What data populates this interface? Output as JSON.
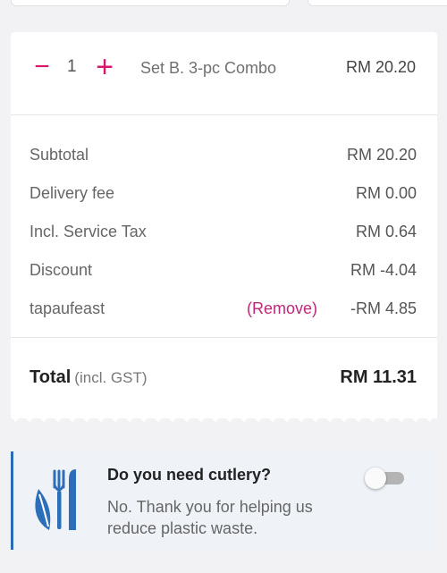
{
  "cart_item": {
    "quantity": "1",
    "minus_symbol": "−",
    "plus_symbol": "+",
    "name": "Set B. 3-pc Combo",
    "price": "RM 20.20"
  },
  "summary": {
    "subtotal": {
      "label": "Subtotal",
      "value": "RM 20.20"
    },
    "delivery_fee": {
      "label": "Delivery fee",
      "value": "RM 0.00"
    },
    "service_tax": {
      "label": "Incl. Service Tax",
      "value": "RM 0.64"
    },
    "discount": {
      "label": "Discount",
      "value": "RM -4.04"
    },
    "voucher": {
      "label": "tapaufeast",
      "remove_label": "(Remove)",
      "value": "-RM 4.85"
    }
  },
  "total": {
    "label": "Total",
    "note": "(incl. GST)",
    "value": "RM 11.31"
  },
  "cutlery": {
    "title": "Do you need cutlery?",
    "description": "No. Thank you for helping us reduce plastic waste.",
    "icon": "leaf-cutlery-icon",
    "toggle_on": false
  },
  "colors": {
    "accent": "#d6166f",
    "link": "#c0267a",
    "info_border": "#2b6ab5",
    "info_bg": "#eff3f8"
  }
}
